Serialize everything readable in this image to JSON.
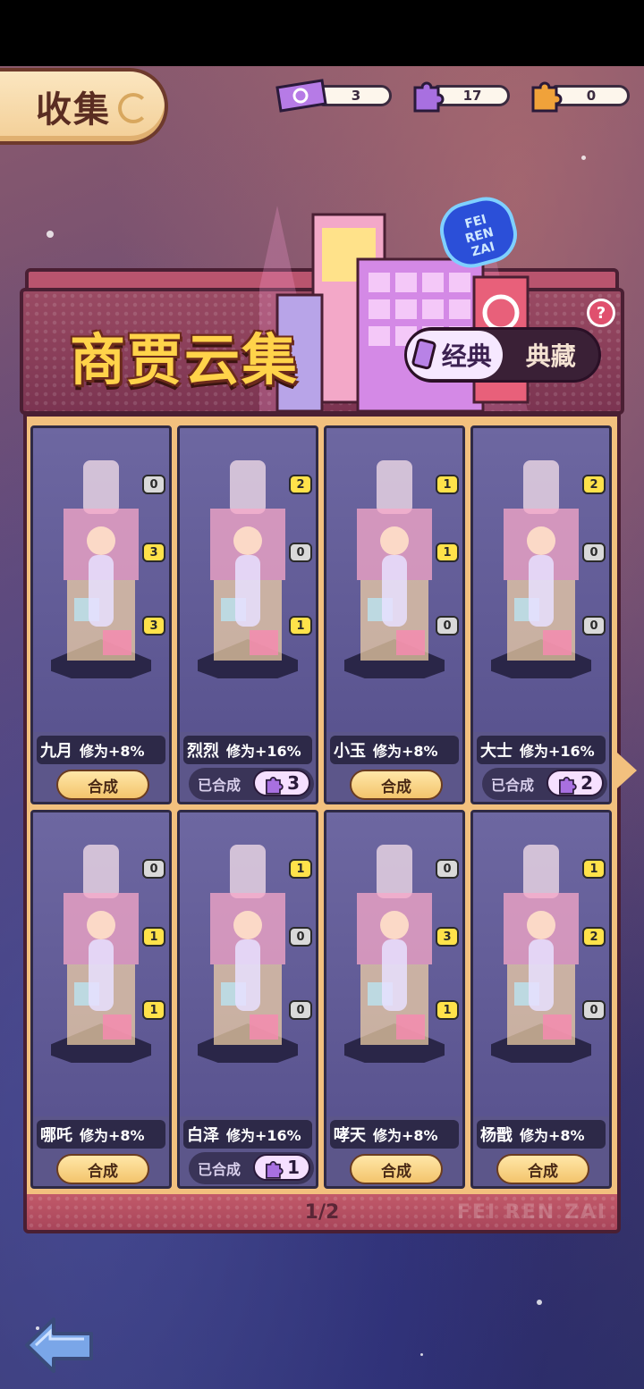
{
  "header": {
    "title": "收集"
  },
  "currencies": [
    {
      "name": "ticket-icon",
      "value": "3",
      "color": "#b67be6"
    },
    {
      "name": "purple-puzzle-icon",
      "value": "17",
      "color": "#a870e0"
    },
    {
      "name": "orange-puzzle-icon",
      "value": "0",
      "color": "#f0a23a"
    }
  ],
  "collection": {
    "title": "商贾云集",
    "tabs": [
      {
        "label": "经典",
        "active": true
      },
      {
        "label": "典藏",
        "active": false
      }
    ],
    "help": "?"
  },
  "characters": [
    {
      "name": "九月",
      "bonus": "修为+8%",
      "pieces": [
        "0",
        "3",
        "3"
      ],
      "merged": false,
      "action": "合成"
    },
    {
      "name": "烈烈",
      "bonus": "修为+16%",
      "pieces": [
        "2",
        "0",
        "1"
      ],
      "merged": true,
      "merged_label": "已合成",
      "count": "3"
    },
    {
      "name": "小玉",
      "bonus": "修为+8%",
      "pieces": [
        "1",
        "1",
        "0"
      ],
      "merged": false,
      "action": "合成"
    },
    {
      "name": "大士",
      "bonus": "修为+16%",
      "pieces": [
        "2",
        "0",
        "0"
      ],
      "merged": true,
      "merged_label": "已合成",
      "count": "2"
    },
    {
      "name": "哪吒",
      "bonus": "修为+8%",
      "pieces": [
        "0",
        "1",
        "1"
      ],
      "merged": false,
      "action": "合成"
    },
    {
      "name": "白泽",
      "bonus": "修为+16%",
      "pieces": [
        "1",
        "0",
        "0"
      ],
      "merged": true,
      "merged_label": "已合成",
      "count": "1"
    },
    {
      "name": "哮天",
      "bonus": "修为+8%",
      "pieces": [
        "0",
        "3",
        "1"
      ],
      "merged": false,
      "action": "合成"
    },
    {
      "name": "杨戬",
      "bonus": "修为+8%",
      "pieces": [
        "1",
        "2",
        "0"
      ],
      "merged": false,
      "action": "合成"
    }
  ],
  "pagination": {
    "label": "1/2"
  },
  "footer_brand": "FEI REN ZAI",
  "sign_text": [
    "FEI",
    "REN",
    "ZAI"
  ]
}
